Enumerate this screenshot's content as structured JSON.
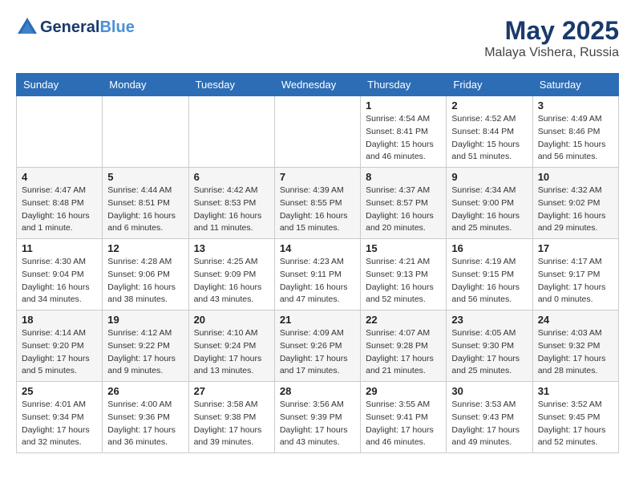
{
  "header": {
    "logo_line1": "General",
    "logo_line2": "Blue",
    "month": "May 2025",
    "location": "Malaya Vishera, Russia"
  },
  "days_of_week": [
    "Sunday",
    "Monday",
    "Tuesday",
    "Wednesday",
    "Thursday",
    "Friday",
    "Saturday"
  ],
  "weeks": [
    [
      {
        "num": "",
        "info": ""
      },
      {
        "num": "",
        "info": ""
      },
      {
        "num": "",
        "info": ""
      },
      {
        "num": "",
        "info": ""
      },
      {
        "num": "1",
        "info": "Sunrise: 4:54 AM\nSunset: 8:41 PM\nDaylight: 15 hours\nand 46 minutes."
      },
      {
        "num": "2",
        "info": "Sunrise: 4:52 AM\nSunset: 8:44 PM\nDaylight: 15 hours\nand 51 minutes."
      },
      {
        "num": "3",
        "info": "Sunrise: 4:49 AM\nSunset: 8:46 PM\nDaylight: 15 hours\nand 56 minutes."
      }
    ],
    [
      {
        "num": "4",
        "info": "Sunrise: 4:47 AM\nSunset: 8:48 PM\nDaylight: 16 hours\nand 1 minute."
      },
      {
        "num": "5",
        "info": "Sunrise: 4:44 AM\nSunset: 8:51 PM\nDaylight: 16 hours\nand 6 minutes."
      },
      {
        "num": "6",
        "info": "Sunrise: 4:42 AM\nSunset: 8:53 PM\nDaylight: 16 hours\nand 11 minutes."
      },
      {
        "num": "7",
        "info": "Sunrise: 4:39 AM\nSunset: 8:55 PM\nDaylight: 16 hours\nand 15 minutes."
      },
      {
        "num": "8",
        "info": "Sunrise: 4:37 AM\nSunset: 8:57 PM\nDaylight: 16 hours\nand 20 minutes."
      },
      {
        "num": "9",
        "info": "Sunrise: 4:34 AM\nSunset: 9:00 PM\nDaylight: 16 hours\nand 25 minutes."
      },
      {
        "num": "10",
        "info": "Sunrise: 4:32 AM\nSunset: 9:02 PM\nDaylight: 16 hours\nand 29 minutes."
      }
    ],
    [
      {
        "num": "11",
        "info": "Sunrise: 4:30 AM\nSunset: 9:04 PM\nDaylight: 16 hours\nand 34 minutes."
      },
      {
        "num": "12",
        "info": "Sunrise: 4:28 AM\nSunset: 9:06 PM\nDaylight: 16 hours\nand 38 minutes."
      },
      {
        "num": "13",
        "info": "Sunrise: 4:25 AM\nSunset: 9:09 PM\nDaylight: 16 hours\nand 43 minutes."
      },
      {
        "num": "14",
        "info": "Sunrise: 4:23 AM\nSunset: 9:11 PM\nDaylight: 16 hours\nand 47 minutes."
      },
      {
        "num": "15",
        "info": "Sunrise: 4:21 AM\nSunset: 9:13 PM\nDaylight: 16 hours\nand 52 minutes."
      },
      {
        "num": "16",
        "info": "Sunrise: 4:19 AM\nSunset: 9:15 PM\nDaylight: 16 hours\nand 56 minutes."
      },
      {
        "num": "17",
        "info": "Sunrise: 4:17 AM\nSunset: 9:17 PM\nDaylight: 17 hours\nand 0 minutes."
      }
    ],
    [
      {
        "num": "18",
        "info": "Sunrise: 4:14 AM\nSunset: 9:20 PM\nDaylight: 17 hours\nand 5 minutes."
      },
      {
        "num": "19",
        "info": "Sunrise: 4:12 AM\nSunset: 9:22 PM\nDaylight: 17 hours\nand 9 minutes."
      },
      {
        "num": "20",
        "info": "Sunrise: 4:10 AM\nSunset: 9:24 PM\nDaylight: 17 hours\nand 13 minutes."
      },
      {
        "num": "21",
        "info": "Sunrise: 4:09 AM\nSunset: 9:26 PM\nDaylight: 17 hours\nand 17 minutes."
      },
      {
        "num": "22",
        "info": "Sunrise: 4:07 AM\nSunset: 9:28 PM\nDaylight: 17 hours\nand 21 minutes."
      },
      {
        "num": "23",
        "info": "Sunrise: 4:05 AM\nSunset: 9:30 PM\nDaylight: 17 hours\nand 25 minutes."
      },
      {
        "num": "24",
        "info": "Sunrise: 4:03 AM\nSunset: 9:32 PM\nDaylight: 17 hours\nand 28 minutes."
      }
    ],
    [
      {
        "num": "25",
        "info": "Sunrise: 4:01 AM\nSunset: 9:34 PM\nDaylight: 17 hours\nand 32 minutes."
      },
      {
        "num": "26",
        "info": "Sunrise: 4:00 AM\nSunset: 9:36 PM\nDaylight: 17 hours\nand 36 minutes."
      },
      {
        "num": "27",
        "info": "Sunrise: 3:58 AM\nSunset: 9:38 PM\nDaylight: 17 hours\nand 39 minutes."
      },
      {
        "num": "28",
        "info": "Sunrise: 3:56 AM\nSunset: 9:39 PM\nDaylight: 17 hours\nand 43 minutes."
      },
      {
        "num": "29",
        "info": "Sunrise: 3:55 AM\nSunset: 9:41 PM\nDaylight: 17 hours\nand 46 minutes."
      },
      {
        "num": "30",
        "info": "Sunrise: 3:53 AM\nSunset: 9:43 PM\nDaylight: 17 hours\nand 49 minutes."
      },
      {
        "num": "31",
        "info": "Sunrise: 3:52 AM\nSunset: 9:45 PM\nDaylight: 17 hours\nand 52 minutes."
      }
    ]
  ]
}
